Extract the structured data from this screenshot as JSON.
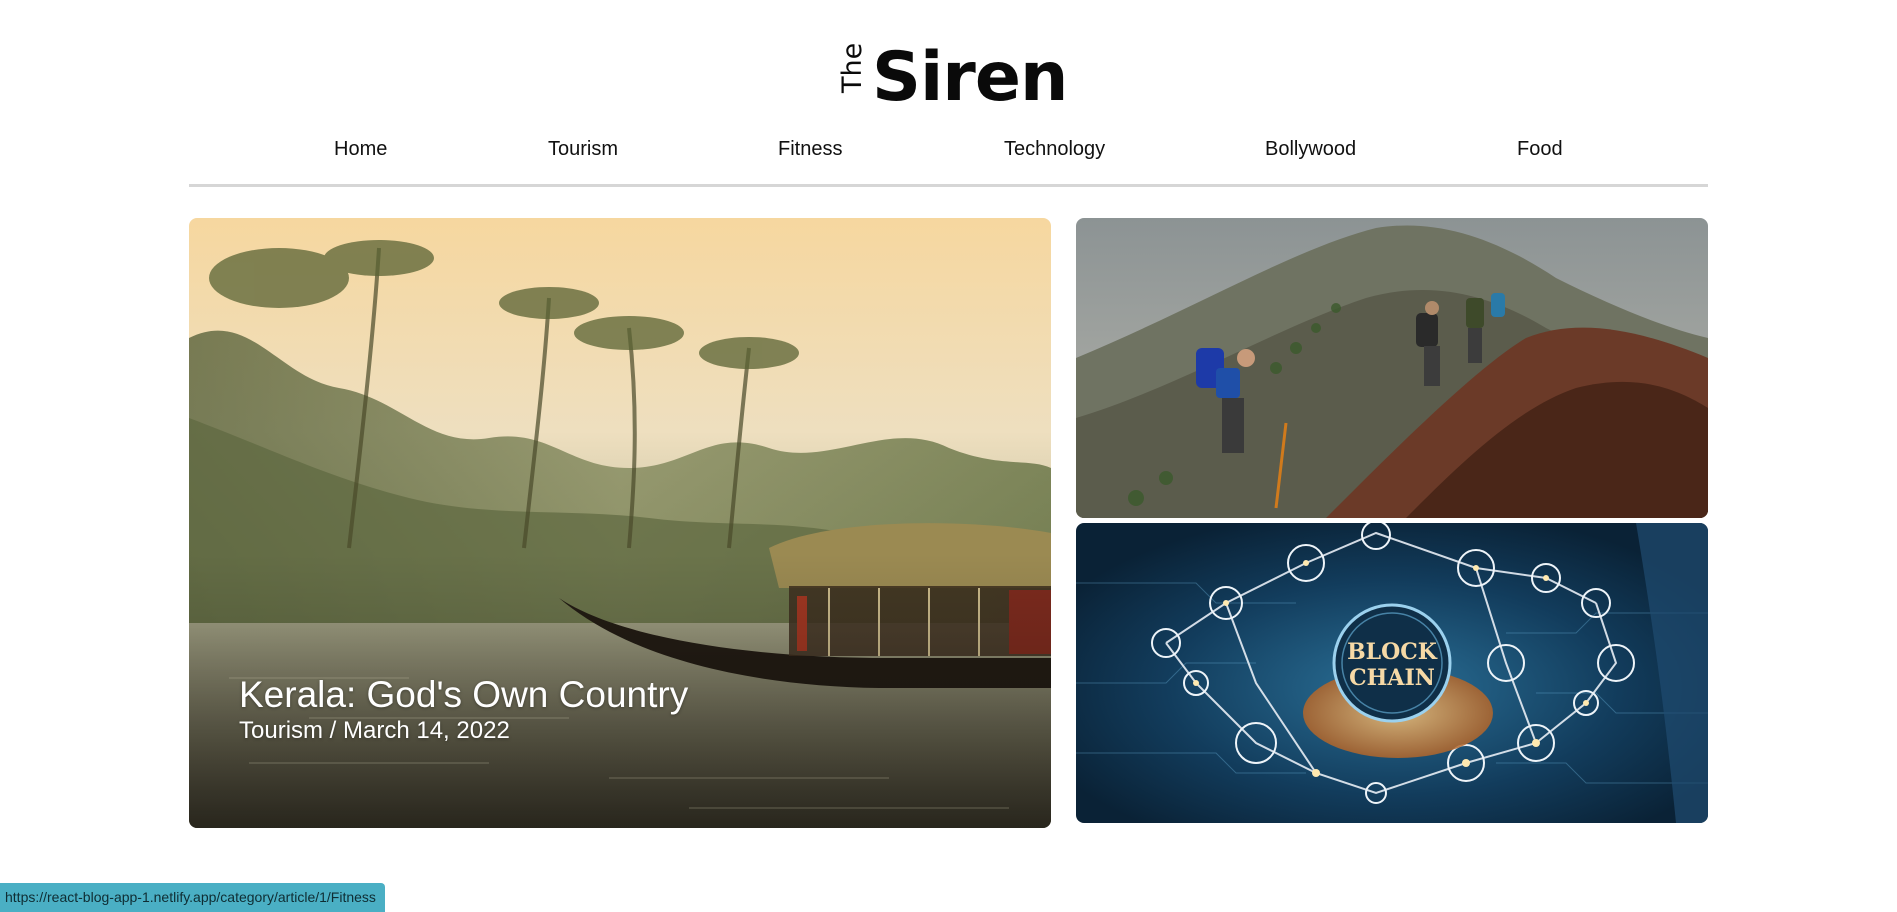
{
  "brand": {
    "prefix": "The",
    "name": "Siren"
  },
  "nav": {
    "items": [
      {
        "label": "Home"
      },
      {
        "label": "Tourism"
      },
      {
        "label": "Fitness"
      },
      {
        "label": "Technology"
      },
      {
        "label": "Bollywood"
      },
      {
        "label": "Food"
      }
    ]
  },
  "hero": {
    "title": "Kerala: God's Own Country",
    "meta": "Tourism / March 14, 2022"
  },
  "side_cards": {
    "hiking": {
      "image": "hikers-mountain-image"
    },
    "blockchain": {
      "image": "blockchain-network-image",
      "image_text_line1": "BLOCK",
      "image_text_line2": "CHAIN"
    }
  },
  "status_bar": {
    "url": "https://react-blog-app-1.netlify.app/category/article/1/Fitness"
  },
  "colors": {
    "nav_divider": "#d6d6d6",
    "status_bar_bg": "#4aafc4",
    "text": "#111111"
  }
}
